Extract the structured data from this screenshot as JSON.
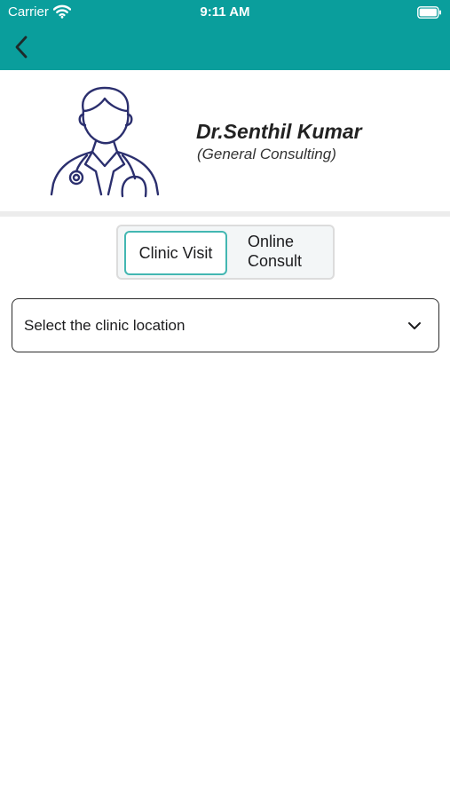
{
  "status_bar": {
    "carrier": "Carrier",
    "time": "9:11 AM",
    "wifi_icon": "wifi-icon",
    "battery_icon": "battery-icon"
  },
  "header": {
    "back_icon": "chevron-left-icon",
    "background_color": "#0a9e9c"
  },
  "doctor": {
    "avatar_icon": "doctor-avatar-icon",
    "name": "Dr.Senthil Kumar",
    "specialty": "(General Consulting)"
  },
  "mode_toggle": {
    "selected": "Clinic Visit",
    "options": [
      {
        "label": "Clinic Visit"
      },
      {
        "label_line1": "Online",
        "label_line2": "Consult"
      }
    ],
    "accent_color": "#43b7b2"
  },
  "location_select": {
    "placeholder": "Select the clinic location",
    "icon": "chevron-down-icon"
  }
}
